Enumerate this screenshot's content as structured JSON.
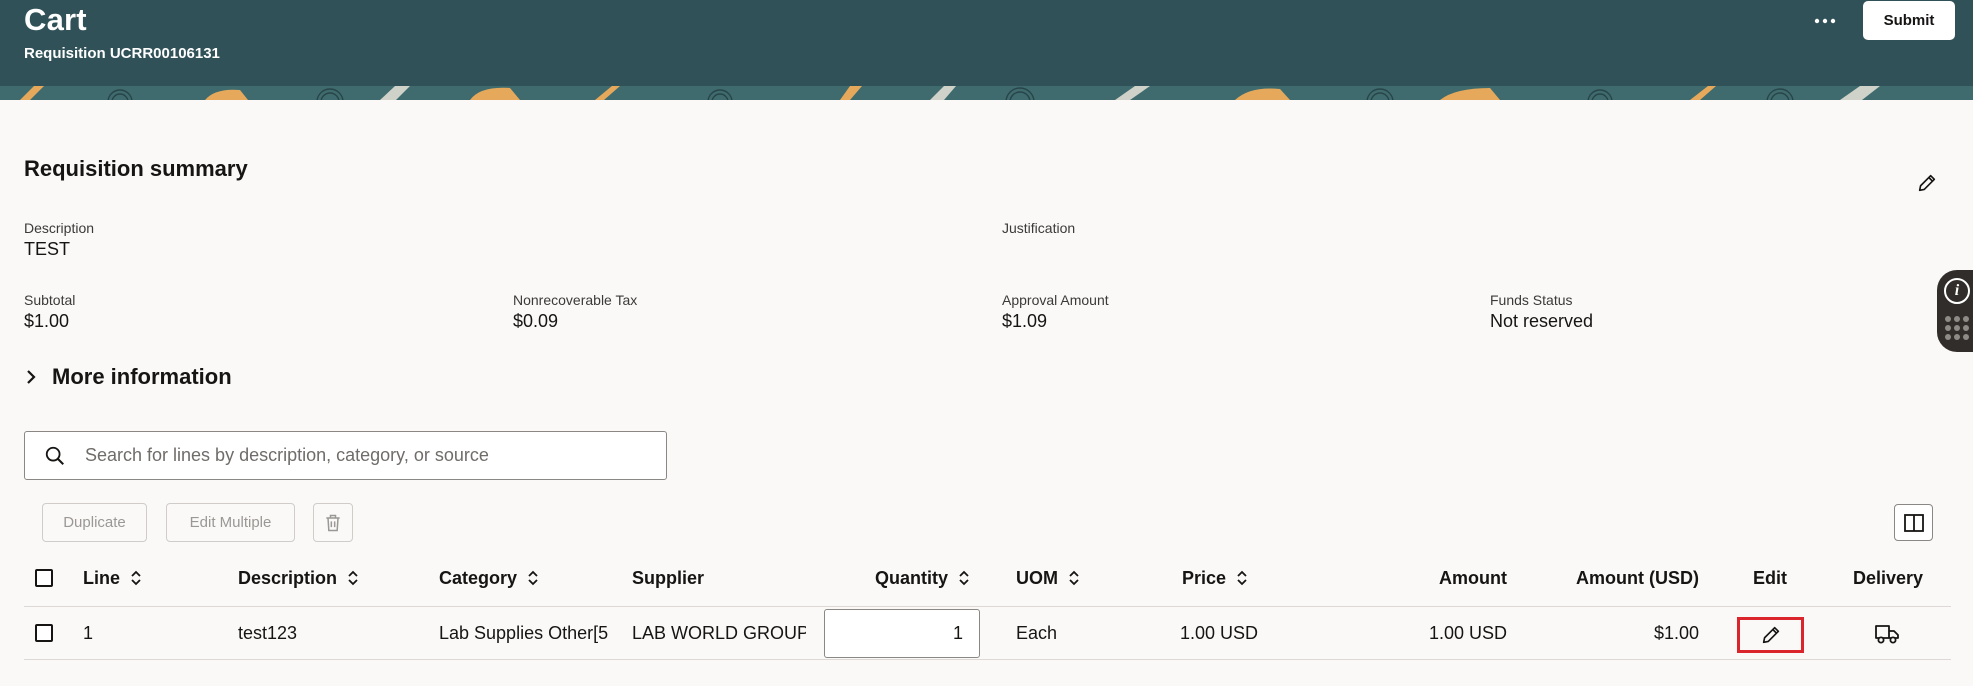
{
  "header": {
    "title": "Cart",
    "subtitle": "Requisition UCRR00106131",
    "submit_label": "Submit",
    "colors": {
      "background": "#2f5157",
      "banner": "#3f6b6e",
      "accent": "#e6a95b"
    }
  },
  "summary": {
    "title": "Requisition summary",
    "fields": {
      "description": {
        "label": "Description",
        "value": "TEST"
      },
      "justification": {
        "label": "Justification",
        "value": ""
      },
      "subtotal": {
        "label": "Subtotal",
        "value": "$1.00"
      },
      "nonrecoverable_tax": {
        "label": "Nonrecoverable Tax",
        "value": "$0.09"
      },
      "approval_amount": {
        "label": "Approval Amount",
        "value": "$1.09"
      },
      "funds_status": {
        "label": "Funds Status",
        "value": "Not reserved"
      }
    }
  },
  "more_info": {
    "label": "More information"
  },
  "search": {
    "placeholder": "Search for lines by description, category, or source",
    "value": ""
  },
  "toolbar": {
    "duplicate_label": "Duplicate",
    "edit_multiple_label": "Edit Multiple"
  },
  "table": {
    "columns": {
      "line": "Line",
      "description": "Description",
      "category": "Category",
      "supplier": "Supplier",
      "quantity": "Quantity",
      "uom": "UOM",
      "price": "Price",
      "amount": "Amount",
      "amount_usd": "Amount (USD)",
      "edit": "Edit",
      "delivery": "Delivery"
    },
    "rows": [
      {
        "line": "1",
        "description": "test123",
        "category": "Lab Supplies Other[5",
        "supplier": "LAB WORLD GROUP",
        "quantity": "1",
        "uom": "Each",
        "price": "1.00 USD",
        "amount": "1.00 USD",
        "amount_usd": "$1.00"
      }
    ]
  },
  "side_panel": {
    "info_glyph": "i"
  },
  "icons": {
    "more": "more-horizontal-icon",
    "edit": "pencil-icon",
    "expand": "chevron-right-icon",
    "search": "search-icon",
    "delete": "trash-icon",
    "layout": "split-columns-icon",
    "sort": "sort-arrows-icon",
    "delivery": "truck-icon",
    "info": "info-icon",
    "apps": "grid-dots-icon"
  }
}
